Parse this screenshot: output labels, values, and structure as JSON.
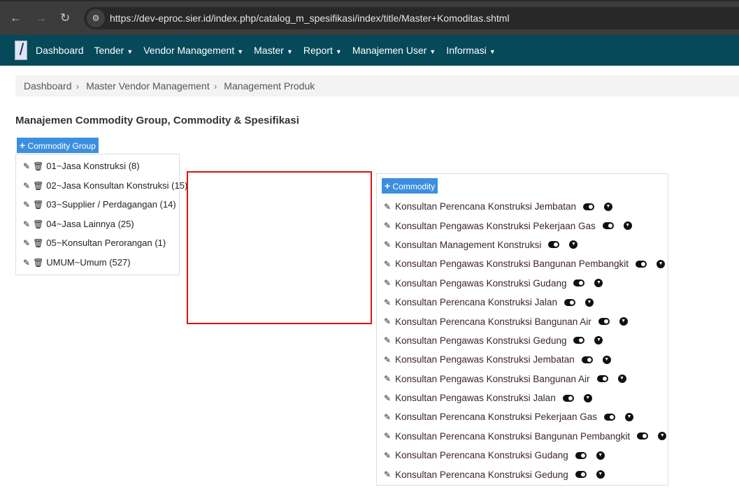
{
  "browser": {
    "url": "https://dev-eproc.sier.id/index.php/catalog_m_spesifikasi/index/title/Master+Komoditas.shtml"
  },
  "navbar": {
    "items": [
      "Dashboard",
      "Tender",
      "Vendor Management",
      "Master",
      "Report",
      "Manajemen User",
      "Informasi"
    ]
  },
  "breadcrumb": [
    "Dashboard",
    "Master Vendor Management",
    "Management Produk"
  ],
  "page_title": "Manajemen Commodity Group, Commodity & Spesifikasi",
  "group_button": "Commodity Group",
  "groups": [
    "01~Jasa Konstruksi (8)",
    "02~Jasa Konsultan Konstruksi (15)",
    "03~Supplier / Perdagangan (14)",
    "04~Jasa Lainnya (25)",
    "05~Konsultan Perorangan (1)",
    "UMUM~Umum (527)"
  ],
  "commodity_button": "Commodity",
  "commodities": [
    "Konsultan Perencana Konstruksi Jembatan",
    "Konsultan Pengawas Konstruksi Pekerjaan Gas",
    "Konsultan Management Konstruksi",
    "Konsultan Pengawas Konstruksi Bangunan Pembangkit",
    "Konsultan Pengawas Konstruksi Gudang",
    "Konsultan Perencana Konstruksi Jalan",
    "Konsultan Perencana Konstruksi Bangunan Air",
    "Konsultan Pengawas Konstruksi Gedung",
    "Konsultan Pengawas Konstruksi Jembatan",
    "Konsultan Pengawas Konstruksi Bangunan Air",
    "Konsultan Pengawas Konstruksi Jalan",
    "Konsultan Perencana Konstruksi Pekerjaan Gas",
    "Konsultan Perencana Konstruksi Bangunan Pembangkit",
    "Konsultan Perencana Konstruksi Gudang",
    "Konsultan Perencana Konstruksi Gedung"
  ]
}
